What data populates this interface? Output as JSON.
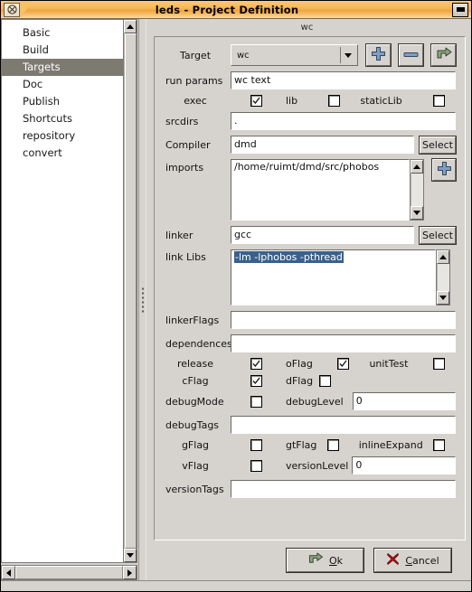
{
  "window": {
    "title": "leds - Project Definition",
    "close_icon": "circle-x-icon",
    "minimize_icon": "minimize-icon"
  },
  "sidebar": {
    "items": [
      {
        "label": "Basic",
        "selected": false
      },
      {
        "label": "Build",
        "selected": false
      },
      {
        "label": "Targets",
        "selected": true
      },
      {
        "label": "Doc",
        "selected": false
      },
      {
        "label": "Publish",
        "selected": false
      },
      {
        "label": "Shortcuts",
        "selected": false
      },
      {
        "label": "repository",
        "selected": false
      },
      {
        "label": "convert",
        "selected": false
      }
    ]
  },
  "main": {
    "tab_label": "wc",
    "target": {
      "label": "Target",
      "value": "wc",
      "add_icon": "plus-icon",
      "remove_icon": "minus-icon",
      "browse_icon": "green-arrow-icon"
    },
    "run_params": {
      "label": "run params",
      "value": "wc text"
    },
    "exec_row": {
      "label": "exec",
      "checkboxes": [
        {
          "name": "exec",
          "label": "",
          "checked": true
        },
        {
          "name": "lib",
          "label": "lib",
          "checked": false
        },
        {
          "name": "staticLib",
          "label": "staticLib",
          "checked": false
        }
      ]
    },
    "srcdirs": {
      "label": "srcdirs",
      "value": "."
    },
    "compiler": {
      "label": "Compiler",
      "value": "dmd",
      "button": "Select"
    },
    "imports": {
      "label": "imports",
      "value": "/home/ruimt/dmd/src/phobos",
      "add_icon": "plus-icon"
    },
    "linker": {
      "label": "linker",
      "value": "gcc",
      "button": "Select"
    },
    "link_libs": {
      "label": "link Libs",
      "value": "-lm -lphobos -pthread",
      "selected": true
    },
    "linker_flags": {
      "label": "linkerFlags",
      "value": ""
    },
    "dependences": {
      "label": "dependences",
      "value": ""
    },
    "release_row": {
      "label": "release",
      "checkboxes": [
        {
          "name": "release",
          "label": "",
          "checked": true
        },
        {
          "name": "oFlag",
          "label": "oFlag",
          "checked": true
        },
        {
          "name": "unitTest",
          "label": "unitTest",
          "checked": false
        }
      ]
    },
    "cflag_row": {
      "label": "cFlag",
      "checkboxes": [
        {
          "name": "cFlag",
          "label": "",
          "checked": true
        },
        {
          "name": "dFlag",
          "label": "dFlag",
          "checked": false
        }
      ]
    },
    "debug_row": {
      "label": "debugMode",
      "checked": false,
      "level_label": "debugLevel",
      "level_value": "0"
    },
    "debug_tags": {
      "label": "debugTags",
      "value": ""
    },
    "gflag_row": {
      "label": "gFlag",
      "checkboxes": [
        {
          "name": "gFlag",
          "label": "",
          "checked": false
        },
        {
          "name": "gtFlag",
          "label": "gtFlag",
          "checked": false
        },
        {
          "name": "inlineExpand",
          "label": "inlineExpand",
          "checked": false
        }
      ]
    },
    "vflag_row": {
      "label": "vFlag",
      "checked": false,
      "level_label": "versionLevel",
      "level_value": "0"
    },
    "version_tags": {
      "label": "versionTags",
      "value": ""
    }
  },
  "footer": {
    "ok": {
      "label": "Ok",
      "underline": "O",
      "rest": "k",
      "icon": "green-arrow-icon"
    },
    "cancel": {
      "label": "Cancel",
      "lead": "C",
      "underline": "C",
      "rest": "ancel",
      "icon": "red-x-icon"
    }
  },
  "colors": {
    "titlebar": "#f6b455",
    "face": "#d6d3ce",
    "selection": "#39618c",
    "sidebar_selected": "#7d7a72",
    "accent_green": "#8aa47e",
    "accent_red": "#b01414"
  }
}
